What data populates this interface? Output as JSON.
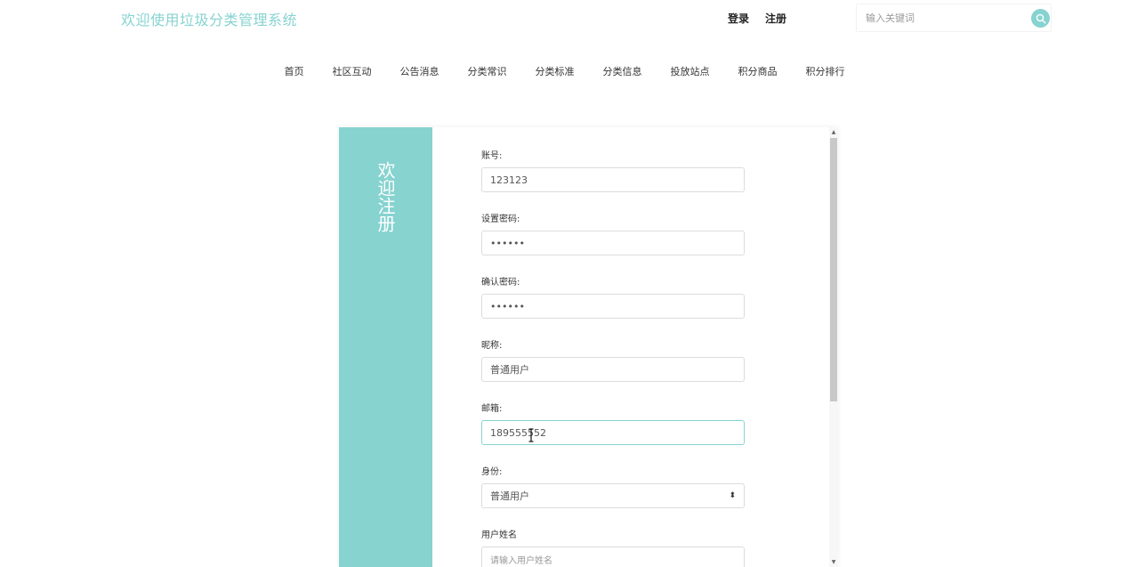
{
  "header": {
    "site_title": "欢迎使用垃圾分类管理系统",
    "login_label": "登录",
    "register_label": "注册",
    "search_placeholder": "输入关键词",
    "search_icon": "search-icon",
    "accent_color": "#86d3d0"
  },
  "nav": {
    "items": [
      {
        "label": "首页"
      },
      {
        "label": "社区互动"
      },
      {
        "label": "公告消息"
      },
      {
        "label": "分类常识"
      },
      {
        "label": "分类标准"
      },
      {
        "label": "分类信息"
      },
      {
        "label": "投放站点"
      },
      {
        "label": "积分商品"
      },
      {
        "label": "积分排行"
      }
    ]
  },
  "register": {
    "side_title": "欢迎注册",
    "fields": [
      {
        "label": "账号:",
        "value": "123123"
      },
      {
        "label": "设置密码:",
        "value": "••••••"
      },
      {
        "label": "确认密码:",
        "value": "••••••"
      },
      {
        "label": "昵称:",
        "value": "普通用户"
      },
      {
        "label": "邮箱:",
        "value": "189555552"
      },
      {
        "label": "身份:",
        "value": "普通用户"
      },
      {
        "label": "用户姓名",
        "placeholder": "请输入用户姓名"
      }
    ]
  }
}
